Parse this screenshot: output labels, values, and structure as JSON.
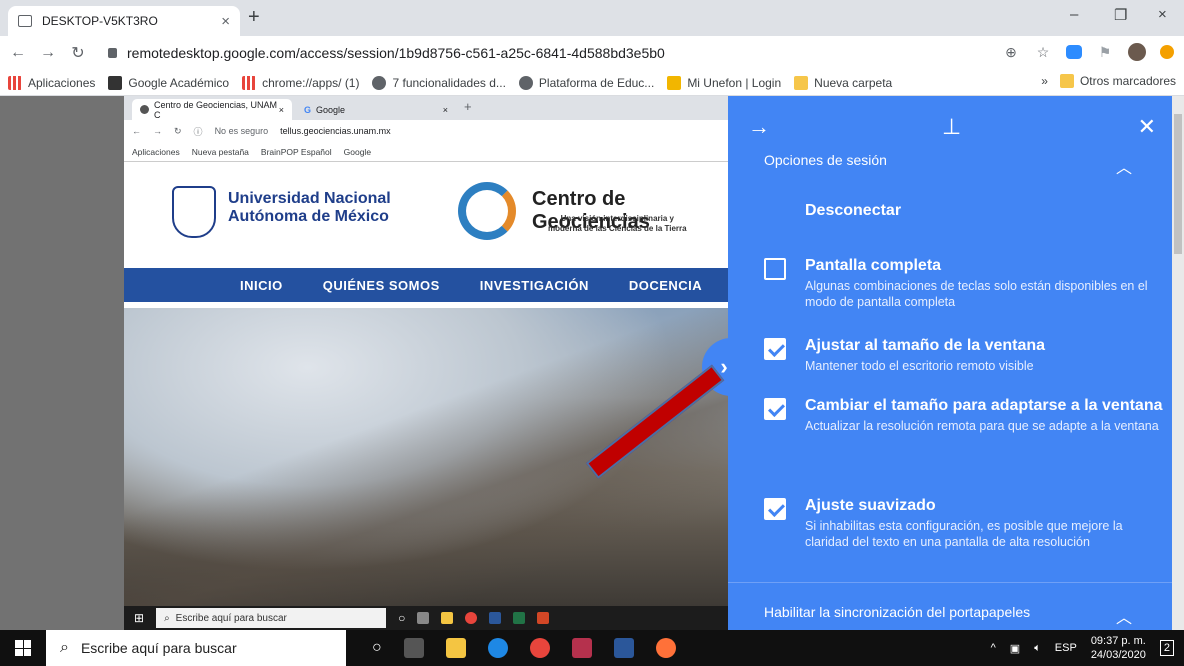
{
  "browser": {
    "tab_title": "DESKTOP-V5KT3RO",
    "tab_close": "×",
    "new_tab": "+",
    "window_minimize": "–",
    "window_restore": "❐",
    "window_close": "×",
    "url": "remotedesktop.google.com/access/session/1b9d8756-c561-a25c-6841-4d588bd3e5b0",
    "bookmarks": [
      {
        "label": "Aplicaciones"
      },
      {
        "label": "Google Académico"
      },
      {
        "label": "chrome://apps/ (1)"
      },
      {
        "label": "7 funcionalidades d..."
      },
      {
        "label": "Plataforma de Educ..."
      },
      {
        "label": "Mi Unefon | Login"
      },
      {
        "label": "Nueva carpeta"
      }
    ],
    "bookmarks_more": "»",
    "other_bookmarks": "Otros marcadores"
  },
  "remote": {
    "tabs": [
      "Centro de Geociencias, UNAM C",
      "Google"
    ],
    "tab_close": "×",
    "tab_new": "+",
    "security": "No es seguro",
    "url": "tellus.geociencias.unam.mx",
    "bookmarks": [
      "Aplicaciones",
      "Nueva pestaña",
      "BrainPOP Español",
      "Google"
    ],
    "site": {
      "unam_line1": "Universidad Nacional",
      "unam_line2": "Autónoma de México",
      "geo_title": "Centro de Geociencias",
      "geo_sub1": "Una visión interdisciplinaria y",
      "geo_sub2": "moderna de las Ciencias de la Tierra",
      "nav": [
        "INICIO",
        "QUIÉNES SOMOS",
        "INVESTIGACIÓN",
        "DOCENCIA"
      ]
    },
    "taskbar_search": "Escribe aquí para buscar"
  },
  "panel": {
    "section_title": "Opciones de sesión",
    "disconnect": "Desconectar",
    "options": [
      {
        "title": "Pantalla completa",
        "desc": "Algunas combinaciones de teclas solo están disponibles en el modo de pantalla completa",
        "checked": false
      },
      {
        "title": "Ajustar al tamaño de la ventana",
        "desc": "Mantener todo el escritorio remoto visible",
        "checked": true
      },
      {
        "title": "Cambiar el tamaño para adaptarse a la ventana",
        "desc": "Actualizar la resolución remota para que se adapte a la ventana",
        "checked": true
      },
      {
        "title": "Ajuste suavizado",
        "desc": "Si inhabilitas esta configuración, es posible que mejore la claridad del texto en una pantalla de alta resolución",
        "checked": true
      }
    ],
    "clipboard_title": "Habilitar la sincronización del portapapeles"
  },
  "taskbar": {
    "search": "Escribe aquí para buscar",
    "lang": "ESP",
    "time": "09:37 p. m.",
    "date": "24/03/2020",
    "notif_count": "2"
  },
  "colors": {
    "panel": "#4285f4",
    "site_nav": "#2451a0",
    "arrow": "#c00000"
  }
}
